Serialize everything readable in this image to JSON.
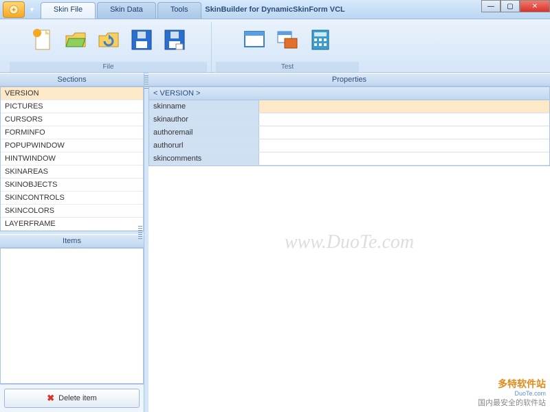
{
  "window": {
    "title": "SkinBuilder for DynamicSkinForm VCL"
  },
  "tabs": [
    {
      "label": "Skin File",
      "active": true
    },
    {
      "label": "Skin Data",
      "active": false
    },
    {
      "label": "Tools",
      "active": false
    }
  ],
  "ribbon": {
    "groups": [
      {
        "label": "File"
      },
      {
        "label": "Test"
      }
    ]
  },
  "left": {
    "sections_header": "Sections",
    "items_header": "Items",
    "sections": [
      "VERSION",
      "PICTURES",
      "CURSORS",
      "FORMINFO",
      "POPUPWINDOW",
      "HINTWINDOW",
      "SKINAREAS",
      "SKINOBJECTS",
      "SKINCONTROLS",
      "SKINCOLORS",
      "LAYERFRAME"
    ],
    "selected_index": 0,
    "delete_label": "Delete item"
  },
  "right": {
    "panel_header": "Properties",
    "group_header": "< VERSION >",
    "rows": [
      {
        "name": "skinname",
        "value": ""
      },
      {
        "name": "skinauthor",
        "value": ""
      },
      {
        "name": "authoremail",
        "value": ""
      },
      {
        "name": "authorurl",
        "value": ""
      },
      {
        "name": "skincomments",
        "value": ""
      }
    ],
    "selected_row": 0
  },
  "watermark": "www.DuoTe.com",
  "corner": {
    "brand": "多特软件站",
    "sub": "DuoTe.com",
    "tagline": "国内最安全的软件站"
  }
}
